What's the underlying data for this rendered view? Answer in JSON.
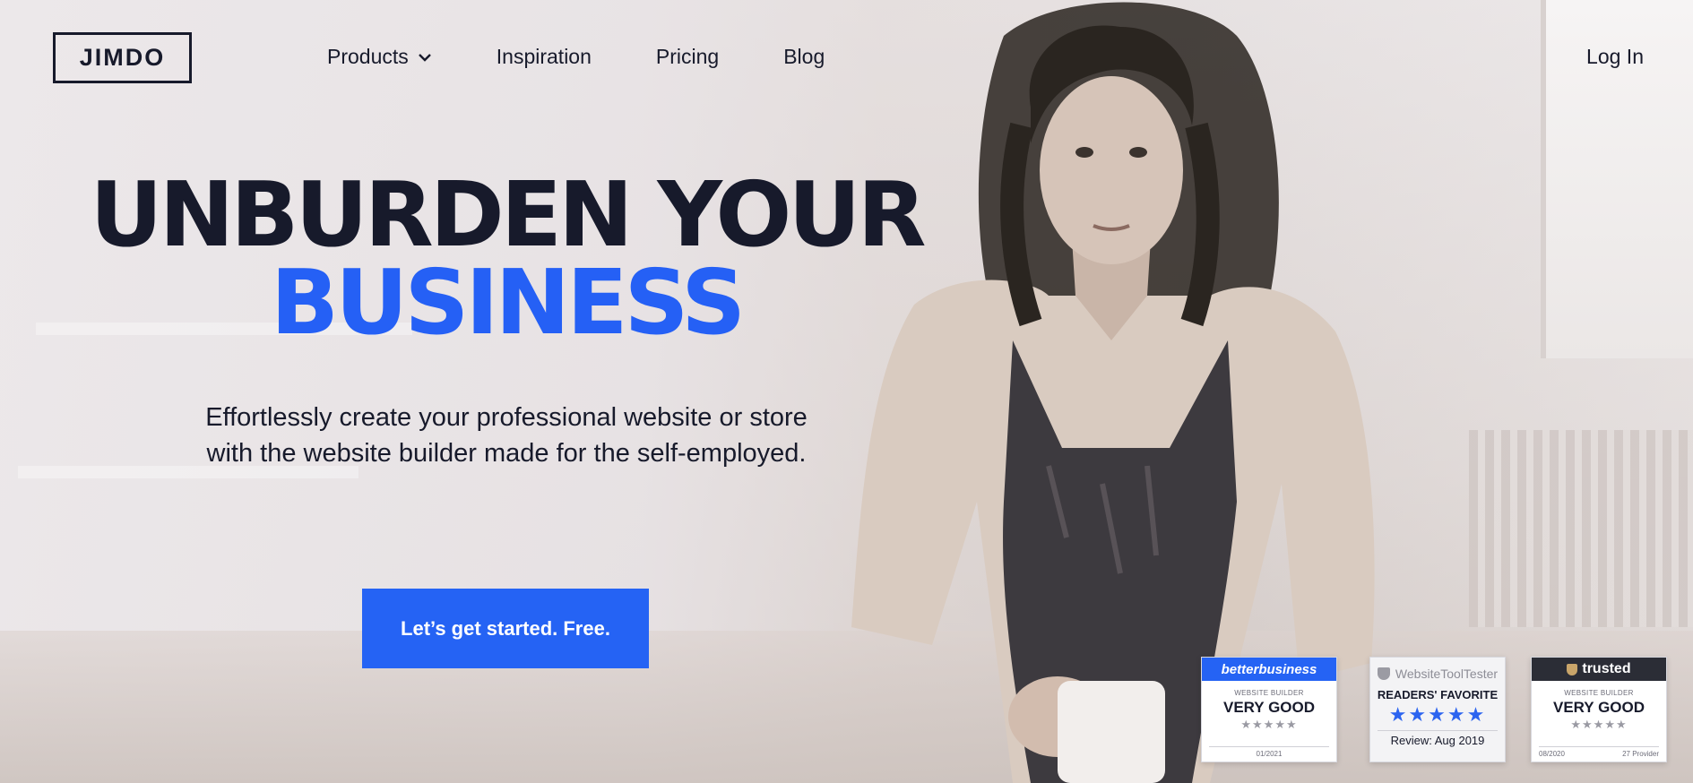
{
  "brand": {
    "logo_text": "JIMDO",
    "accent": "#2563f4",
    "ink": "#171a2b"
  },
  "nav": {
    "items": [
      {
        "label": "Products",
        "has_dropdown": true
      },
      {
        "label": "Inspiration"
      },
      {
        "label": "Pricing"
      },
      {
        "label": "Blog"
      }
    ],
    "login_label": "Log In"
  },
  "hero": {
    "headline_line1": "UNBURDEN YOUR",
    "headline_line2": "BUSINESS",
    "subtitle": "Effortlessly create your professional website or store with the website builder made for the self-employed.",
    "cta_label": "Let’s get started. Free."
  },
  "badges": [
    {
      "brand": "betterbusiness",
      "category": "WEBSITE BUILDER",
      "rating": "VERY GOOD",
      "stars": "★★★★★",
      "date": "01/2021",
      "color": "#2563f4"
    },
    {
      "brand": "WebsiteToolTester",
      "title": "READERS' FAVORITE",
      "stars": "★★★★★",
      "review": "Review: Aug 2019"
    },
    {
      "brand": "trusted",
      "category": "WEBSITE BUILDER",
      "rating": "VERY GOOD",
      "stars": "★★★★★",
      "date": "08/2020",
      "provider": "27 Provider",
      "color": "#2b2d36"
    }
  ]
}
